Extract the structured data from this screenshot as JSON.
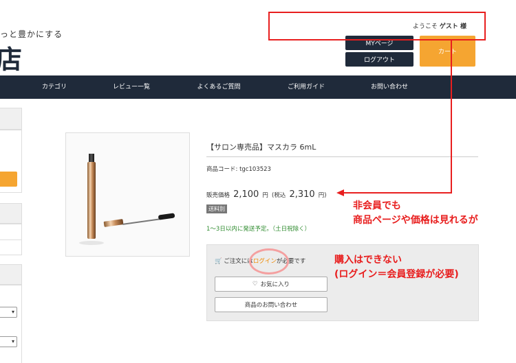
{
  "header": {
    "tagline": "っと豊かにする",
    "logo_fragment": "店",
    "welcome_prefix": "ようこそ",
    "welcome_user": "ゲスト 様",
    "mypage_label": "MYページ",
    "logout_label": "ログアウト",
    "cart_label": "カート"
  },
  "nav": {
    "items": [
      "カテゴリ",
      "レビュー一覧",
      "よくあるご質問",
      "ご利用ガイド",
      "お問い合わせ"
    ]
  },
  "product": {
    "title": "【サロン専売品】マスカラ 6mL",
    "code_label": "商品コード:",
    "code_value": "tgc103523",
    "price_label": "販売価格",
    "price": "2,100",
    "yen": "円",
    "tax_open": "(税込",
    "price_tax": "2,310",
    "tax_close": "円)",
    "shipping_badge": "送料別",
    "shipping_note": "1〜3日以内に発送予定。（土日祝除く）"
  },
  "purchase": {
    "msg_prefix": "ご注文には",
    "msg_link": "ログイン",
    "msg_suffix": "が必要です",
    "favorite_label": "お気に入り",
    "inquiry_label": "商品のお問い合わせ"
  },
  "annotations": {
    "note1_line1": "非会員でも",
    "note1_line2": "商品ページや価格は見れるが",
    "note2_line1": "購入はできない",
    "note2_line2": "(ログイン＝会員登録が必要)"
  },
  "colors": {
    "navy": "#1f2a3a",
    "accent_orange": "#f5a531",
    "annotation_red": "#e81e1e"
  }
}
